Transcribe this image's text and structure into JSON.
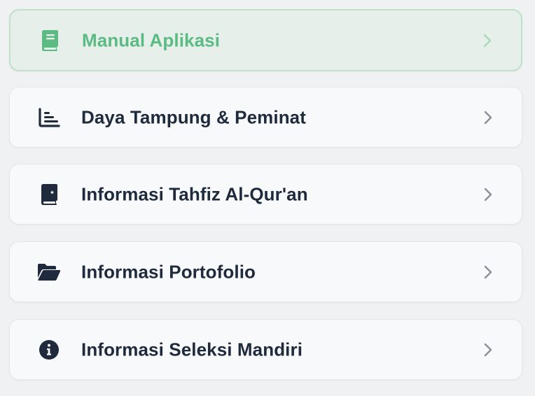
{
  "menu": {
    "items": [
      {
        "label": "Manual Aplikasi",
        "icon": "book-icon",
        "active": true
      },
      {
        "label": "Daya Tampung & Peminat",
        "icon": "chart-icon",
        "active": false
      },
      {
        "label": "Informasi Tahfiz Al-Qur'an",
        "icon": "quran-icon",
        "active": false
      },
      {
        "label": "Informasi Portofolio",
        "icon": "folder-open-icon",
        "active": false
      },
      {
        "label": "Informasi Seleksi Mandiri",
        "icon": "info-icon",
        "active": false
      }
    ]
  },
  "colors": {
    "accent": "#5bbb83",
    "text": "#1f2a3c",
    "chevron": "#8a8f97",
    "active_bg": "#e6efea",
    "card_bg": "#f8f9fb"
  }
}
